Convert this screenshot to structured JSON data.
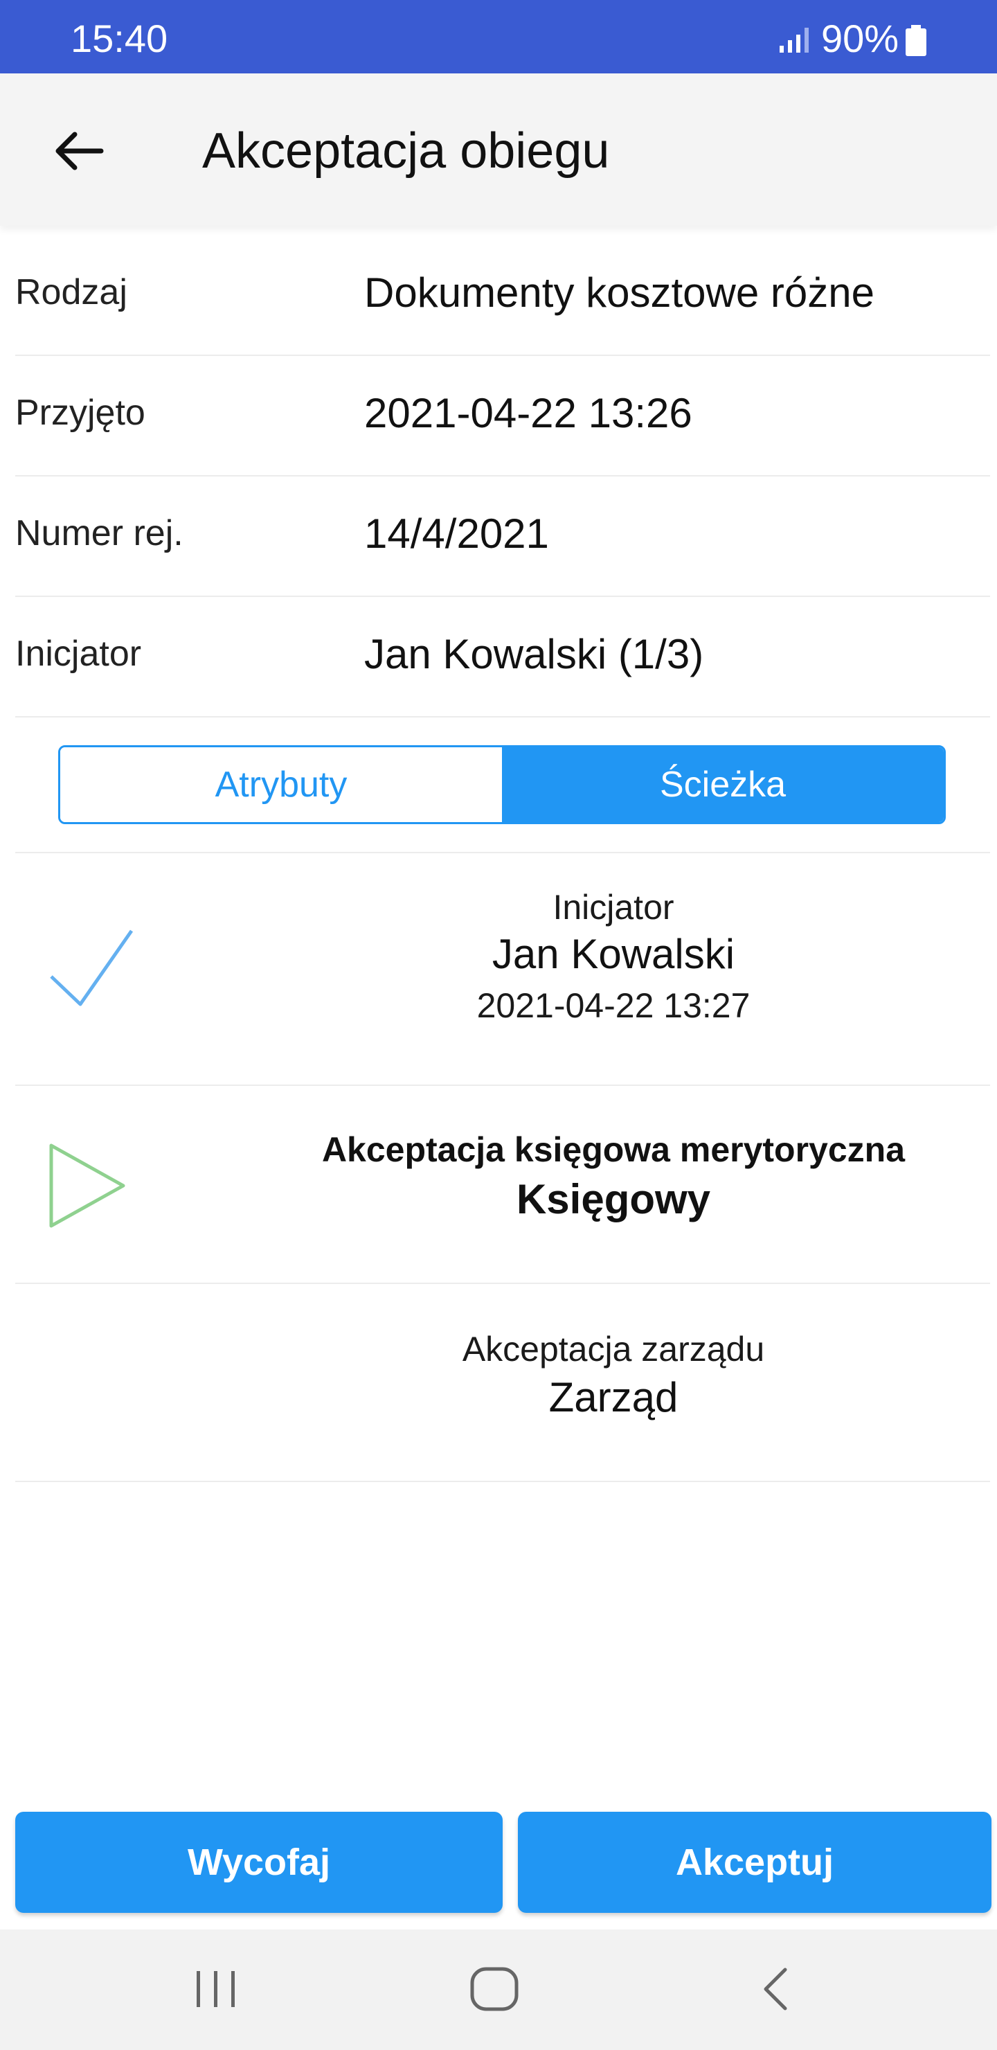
{
  "status_bar": {
    "time": "15:40",
    "battery_percent": "90%",
    "signal_icon": "signal-bars-icon",
    "battery_icon": "battery-icon"
  },
  "header": {
    "back_icon": "arrow-left-icon",
    "title": "Akceptacja obiegu"
  },
  "details": [
    {
      "label": "Rodzaj",
      "value": "Dokumenty kosztowe różne"
    },
    {
      "label": "Przyjęto",
      "value": "2021-04-22 13:26"
    },
    {
      "label": "Numer rej.",
      "value": "14/4/2021"
    },
    {
      "label": "Inicjator",
      "value": "Jan Kowalski (1/3)"
    }
  ],
  "tabs": {
    "items": [
      {
        "label": "Atrybuty",
        "selected": false
      },
      {
        "label": "Ścieżka",
        "selected": true
      }
    ]
  },
  "path": [
    {
      "status_icon": "checkmark-icon",
      "title": "Inicjator",
      "person": "Jan Kowalski",
      "date": "2021-04-22 13:27"
    },
    {
      "status_icon": "play-triangle-icon",
      "title": "Akceptacja księgowa merytoryczna",
      "person": "Księgowy"
    },
    {
      "status_icon": "",
      "title": "Akceptacja zarządu",
      "person": "Zarząd"
    }
  ],
  "actions": {
    "withdraw_label": "Wycofaj",
    "accept_label": "Akceptuj"
  },
  "nav_bar": {
    "recents_icon": "recents-icon",
    "home_icon": "home-icon",
    "back_icon": "nav-back-icon"
  },
  "colors": {
    "status_bar": "#3a5bd2",
    "accent": "#2196f3",
    "check": "#64b0f0",
    "current_step": "#8fd18f"
  }
}
